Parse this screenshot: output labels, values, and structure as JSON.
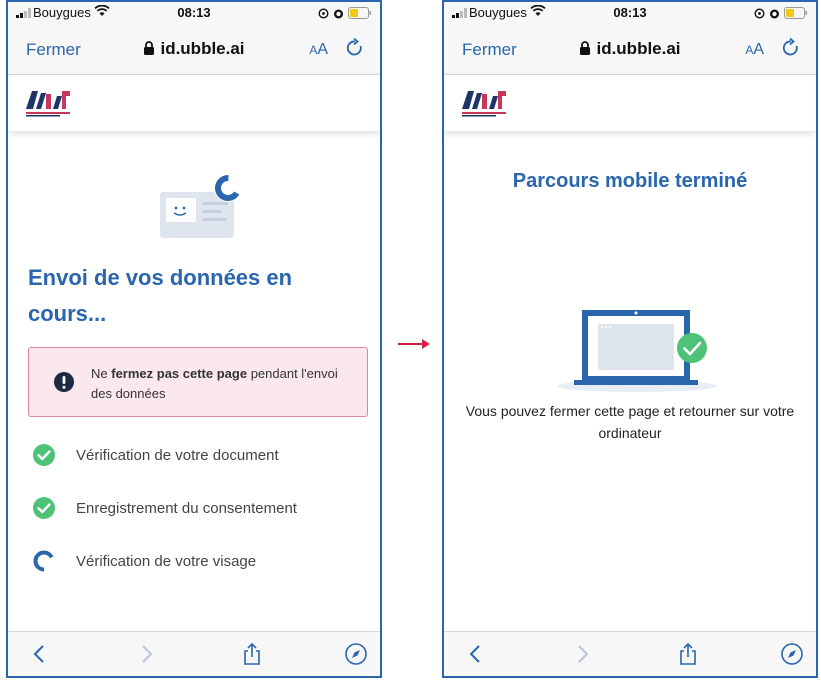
{
  "status_bar": {
    "carrier": "Bouygues",
    "time": "08:13"
  },
  "browser": {
    "close_label": "Fermer",
    "url": "id.ubble.ai",
    "text_size_small": "A",
    "text_size_big": "A"
  },
  "left_page": {
    "title": "Envoi de vos données en cours...",
    "warning": {
      "prefix": "Ne ",
      "bold": "fermez pas cette page",
      "suffix": " pendant l'envoi des données"
    },
    "steps": [
      {
        "label": "Vérification de votre document",
        "status": "done"
      },
      {
        "label": "Enregistrement du consentement",
        "status": "done"
      },
      {
        "label": "Vérification de votre visage",
        "status": "in-progress"
      }
    ]
  },
  "right_page": {
    "title": "Parcours mobile terminé",
    "message": "Vous pouvez fermer cette page et retourner sur votre ordinateur"
  },
  "colors": {
    "accent": "#2a66ad",
    "success": "#4fc27a",
    "warning_bg": "#fbe8ee",
    "warning_border": "#d48a9a",
    "transition_arrow": "#d6204b"
  },
  "icons": [
    "signal-icon",
    "wifi-icon",
    "battery-icon",
    "lock-icon",
    "reload-icon",
    "back-icon",
    "forward-icon",
    "share-icon",
    "compass-icon",
    "exclamation-icon",
    "check-icon",
    "spinner-icon"
  ]
}
